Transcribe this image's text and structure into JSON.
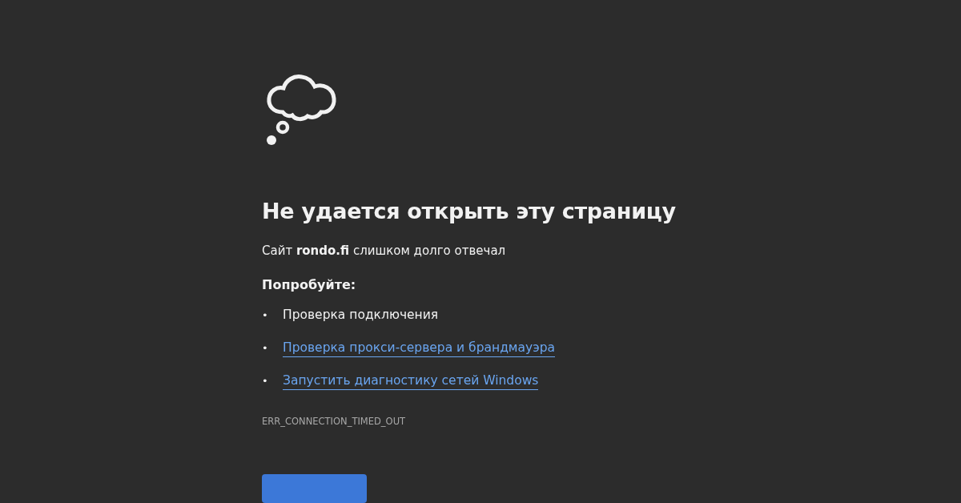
{
  "heading": "Не удается открыть эту страницу",
  "message": "Сайт **rondo.fi** слишком долго отвечал",
  "suggestions_title": "Попробуйте:",
  "suggestions": [
    {
      "bullet": "•",
      "text": "Проверка подключения",
      "kind": "text"
    },
    {
      "bullet": "•",
      "text": "Проверка прокси-сервера и брандмауэра",
      "kind": "link"
    },
    {
      "bullet": "•",
      "text": "Запустить диагностику сетей Windows",
      "kind": "link"
    }
  ],
  "error_code": "ERR_CONNECTION_TIMED_OUT",
  "action_button": {
    "kind": "primary"
  }
}
